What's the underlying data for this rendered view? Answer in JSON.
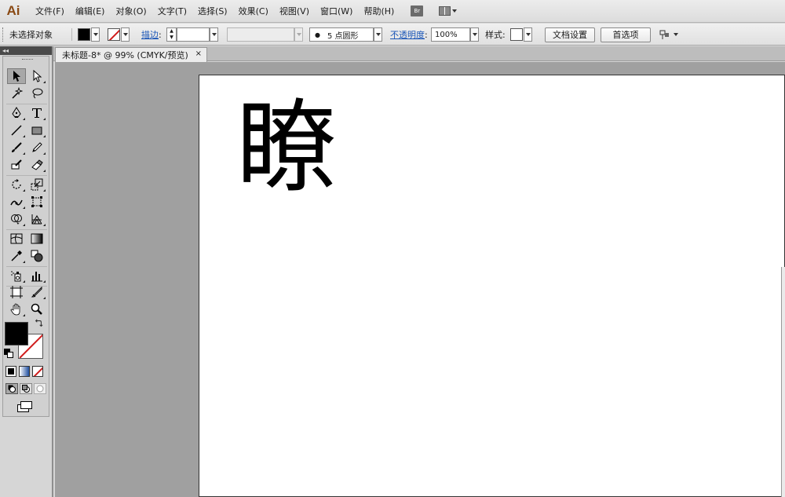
{
  "app": {
    "logo": "Ai",
    "bridge_label": "Br"
  },
  "menu": [
    {
      "id": "file",
      "label": "文件(F)"
    },
    {
      "id": "edit",
      "label": "编辑(E)"
    },
    {
      "id": "object",
      "label": "对象(O)"
    },
    {
      "id": "type",
      "label": "文字(T)"
    },
    {
      "id": "select",
      "label": "选择(S)"
    },
    {
      "id": "effect",
      "label": "效果(C)"
    },
    {
      "id": "view",
      "label": "视图(V)"
    },
    {
      "id": "window",
      "label": "窗口(W)"
    },
    {
      "id": "help",
      "label": "帮助(H)"
    }
  ],
  "control_bar": {
    "selection_status": "未选择对象",
    "stroke_label": "描边",
    "stroke_colon": ":",
    "brush_label": "5 点圆形",
    "opacity_label": "不透明度",
    "opacity_colon": ":",
    "opacity_value": "100%",
    "style_label": "样式:",
    "doc_setup_button": "文档设置",
    "preferences_button": "首选项",
    "colors": {
      "fill": "#000000",
      "stroke_none_line": "#d01c1c"
    }
  },
  "document": {
    "tab_title": "未标题-8* @ 99% (CMYK/预览)",
    "tab_close": "×",
    "artboard_text": "瞭"
  },
  "tools_panel": {
    "collapse_label": "◂◂",
    "tools": [
      "selection-tool-icon",
      "direct-selection-tool-icon",
      "magic-wand-tool-icon",
      "lasso-tool-icon",
      "pen-tool-icon",
      "type-tool-icon",
      "line-segment-tool-icon",
      "rectangle-tool-icon",
      "paintbrush-tool-icon",
      "pencil-tool-icon",
      "blob-brush-tool-icon",
      "eraser-tool-icon",
      "rotate-tool-icon",
      "scale-tool-icon",
      "width-tool-icon",
      "free-transform-tool-icon",
      "shape-builder-tool-icon",
      "perspective-grid-tool-icon",
      "mesh-tool-icon",
      "gradient-tool-icon",
      "eyedropper-tool-icon",
      "blend-tool-icon",
      "symbol-sprayer-tool-icon",
      "column-graph-tool-icon",
      "artboard-tool-icon",
      "slice-tool-icon",
      "hand-tool-icon",
      "zoom-tool-icon"
    ]
  }
}
